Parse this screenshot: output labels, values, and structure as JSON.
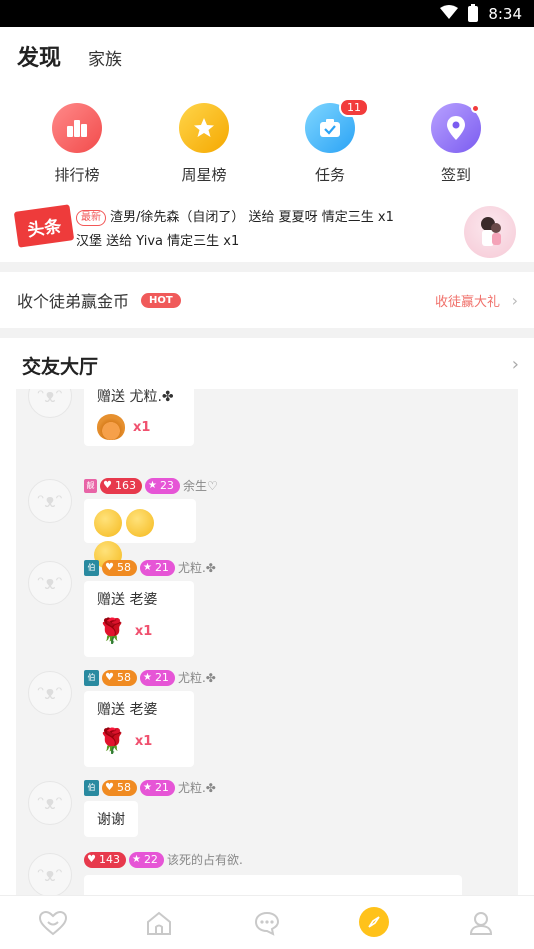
{
  "status_bar": {
    "time": "8:34"
  },
  "header": {
    "tabs": [
      {
        "label": "发现"
      },
      {
        "label": "家族"
      }
    ]
  },
  "quick_actions": [
    {
      "label": "排行榜",
      "icon": "bar-chart-icon"
    },
    {
      "label": "周星榜",
      "icon": "star-icon"
    },
    {
      "label": "任务",
      "icon": "task-icon",
      "badge": "11"
    },
    {
      "label": "签到",
      "icon": "location-pin-icon"
    }
  ],
  "headline": {
    "logo": "头条",
    "tag": "最新",
    "line1": "渣男/徐先森（自闭了） 送给 夏夏呀     情定三生 x1",
    "line2": "汉堡 送给 Yiva     情定三生 x1"
  },
  "recruit": {
    "title": "收个徒弟赢金币",
    "hot": "HOT",
    "link": "收徒赢大礼"
  },
  "hall": {
    "title": "交友大厅",
    "messages": [
      {
        "text": "赠送 尤粒.✤",
        "gift_count": "x1"
      },
      {
        "badge1": "163",
        "badge2": "23",
        "name": "余生♡"
      },
      {
        "badge1": "58",
        "badge2": "21",
        "name": "尤粒.✤",
        "text": "赠送 老婆",
        "gift_count": "x1"
      },
      {
        "badge1": "58",
        "badge2": "21",
        "name": "尤粒.✤",
        "text": "赠送 老婆",
        "gift_count": "x1"
      },
      {
        "badge1": "58",
        "badge2": "21",
        "name": "尤粒.✤",
        "text": "谢谢"
      },
      {
        "badge1": "143",
        "badge2": "22",
        "name": "该死的占有欲."
      }
    ]
  },
  "bottom_nav": [
    {
      "icon": "heart-face-icon"
    },
    {
      "icon": "home-icon"
    },
    {
      "icon": "chat-bubble-icon"
    },
    {
      "icon": "discover-compass-icon"
    },
    {
      "icon": "profile-icon"
    }
  ]
}
